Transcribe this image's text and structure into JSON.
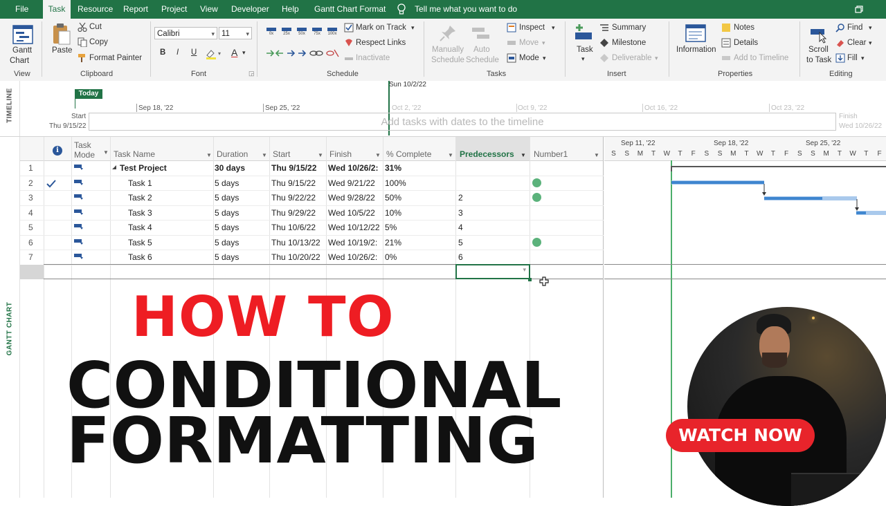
{
  "menu": {
    "tabs": [
      "File",
      "Task",
      "Resource",
      "Report",
      "Project",
      "View",
      "Developer",
      "Help",
      "Gantt Chart Format"
    ],
    "active": "Task",
    "tell_me": "Tell me what you want to do"
  },
  "ribbon": {
    "view": {
      "gantt": "Gantt",
      "chart": "Chart",
      "group": "View"
    },
    "clipboard": {
      "paste": "Paste",
      "cut": "Cut",
      "copy": "Copy",
      "format_painter": "Format Painter",
      "group": "Clipboard"
    },
    "font": {
      "family": "Calibri",
      "size": "11",
      "bold": "B",
      "italic": "I",
      "underline": "U",
      "font_color": "A",
      "group": "Font"
    },
    "schedule": {
      "pct": [
        "0x",
        "25x",
        "50x",
        "75x",
        "100x"
      ],
      "mark_on_track": "Mark on Track",
      "respect_links": "Respect Links",
      "inactivate": "Inactivate",
      "group": "Schedule"
    },
    "tasks": {
      "manually": "Manually",
      "schedule": "Schedule",
      "auto": "Auto",
      "auto_schedule": "Schedule",
      "inspect": "Inspect",
      "move": "Move",
      "mode": "Mode",
      "group": "Tasks"
    },
    "insert": {
      "task": "Task",
      "summary": "Summary",
      "milestone": "Milestone",
      "deliverable": "Deliverable",
      "group": "Insert"
    },
    "properties": {
      "information": "Information",
      "notes": "Notes",
      "details": "Details",
      "add_to_timeline": "Add to Timeline",
      "group": "Properties"
    },
    "editing": {
      "scroll": "Scroll",
      "to_task": "to Task",
      "find": "Find",
      "clear": "Clear",
      "fill": "Fill",
      "group": "Editing"
    }
  },
  "timeline": {
    "side_label": "TIMELINE",
    "today": "Today",
    "current_date": "Sun 10/2/22",
    "start_label": "Start",
    "start_date": "Thu 9/15/22",
    "finish_label": "Finish",
    "finish_date": "Wed 10/26/22",
    "ticks": [
      "Sep 18, '22",
      "Sep 25, '22",
      "Oct 2, '22",
      "Oct 9, '22",
      "Oct 16, '22",
      "Oct 23, '22"
    ],
    "placeholder": "Add tasks with dates to the timeline"
  },
  "grid": {
    "side_label": "GANTT CHART",
    "headers": {
      "info": "i",
      "mode_line1": "Task",
      "mode_line2": "Mode",
      "name": "Task Name",
      "duration": "Duration",
      "start": "Start",
      "finish": "Finish",
      "pct": "% Complete",
      "pred": "Predecessors",
      "number1": "Number1"
    },
    "rows": [
      {
        "id": "1",
        "name": "Test Project",
        "duration": "30 days",
        "start": "Thu 9/15/22",
        "finish": "Wed 10/26/2:",
        "pct": "31%",
        "pred": "",
        "dot": false,
        "check": false,
        "summary": true
      },
      {
        "id": "2",
        "name": "Task 1",
        "duration": "5 days",
        "start": "Thu 9/15/22",
        "finish": "Wed 9/21/22",
        "pct": "100%",
        "pred": "",
        "dot": true,
        "check": true,
        "summary": false
      },
      {
        "id": "3",
        "name": "Task 2",
        "duration": "5 days",
        "start": "Thu 9/22/22",
        "finish": "Wed 9/28/22",
        "pct": "50%",
        "pred": "2",
        "dot": true,
        "check": false,
        "summary": false
      },
      {
        "id": "4",
        "name": "Task 3",
        "duration": "5 days",
        "start": "Thu 9/29/22",
        "finish": "Wed 10/5/22",
        "pct": "10%",
        "pred": "3",
        "dot": false,
        "check": false,
        "summary": false
      },
      {
        "id": "5",
        "name": "Task 4",
        "duration": "5 days",
        "start": "Thu 10/6/22",
        "finish": "Wed 10/12/22",
        "pct": "5%",
        "pred": "4",
        "dot": false,
        "check": false,
        "summary": false
      },
      {
        "id": "6",
        "name": "Task 5",
        "duration": "5 days",
        "start": "Thu 10/13/22",
        "finish": "Wed 10/19/2:",
        "pct": "21%",
        "pred": "5",
        "dot": true,
        "check": false,
        "summary": false
      },
      {
        "id": "7",
        "name": "Task 6",
        "duration": "5 days",
        "start": "Thu 10/20/22",
        "finish": "Wed 10/26/2:",
        "pct": "0%",
        "pred": "6",
        "dot": false,
        "check": false,
        "summary": false
      }
    ]
  },
  "gantt": {
    "weeks": [
      "Sep 11, '22",
      "Sep 18, '22",
      "Sep 25, '22"
    ],
    "days": [
      "S",
      "S",
      "M",
      "T",
      "W",
      "T",
      "F",
      "S",
      "S",
      "M",
      "T",
      "W",
      "T",
      "F",
      "S",
      "S",
      "M",
      "T",
      "W",
      "T",
      "F"
    ]
  },
  "overlay": {
    "line1": "HOW TO",
    "line2": "CONDITIONAL",
    "line3": "FORMATTING",
    "cta": "WATCH NOW"
  },
  "colors": {
    "brand_green": "#217346",
    "headline_red": "#ee1d23",
    "headline_black": "#111111",
    "cta_red": "#e8242b",
    "bar_blue": "#5b9bd5",
    "indicator_green": "#5bb27b"
  }
}
